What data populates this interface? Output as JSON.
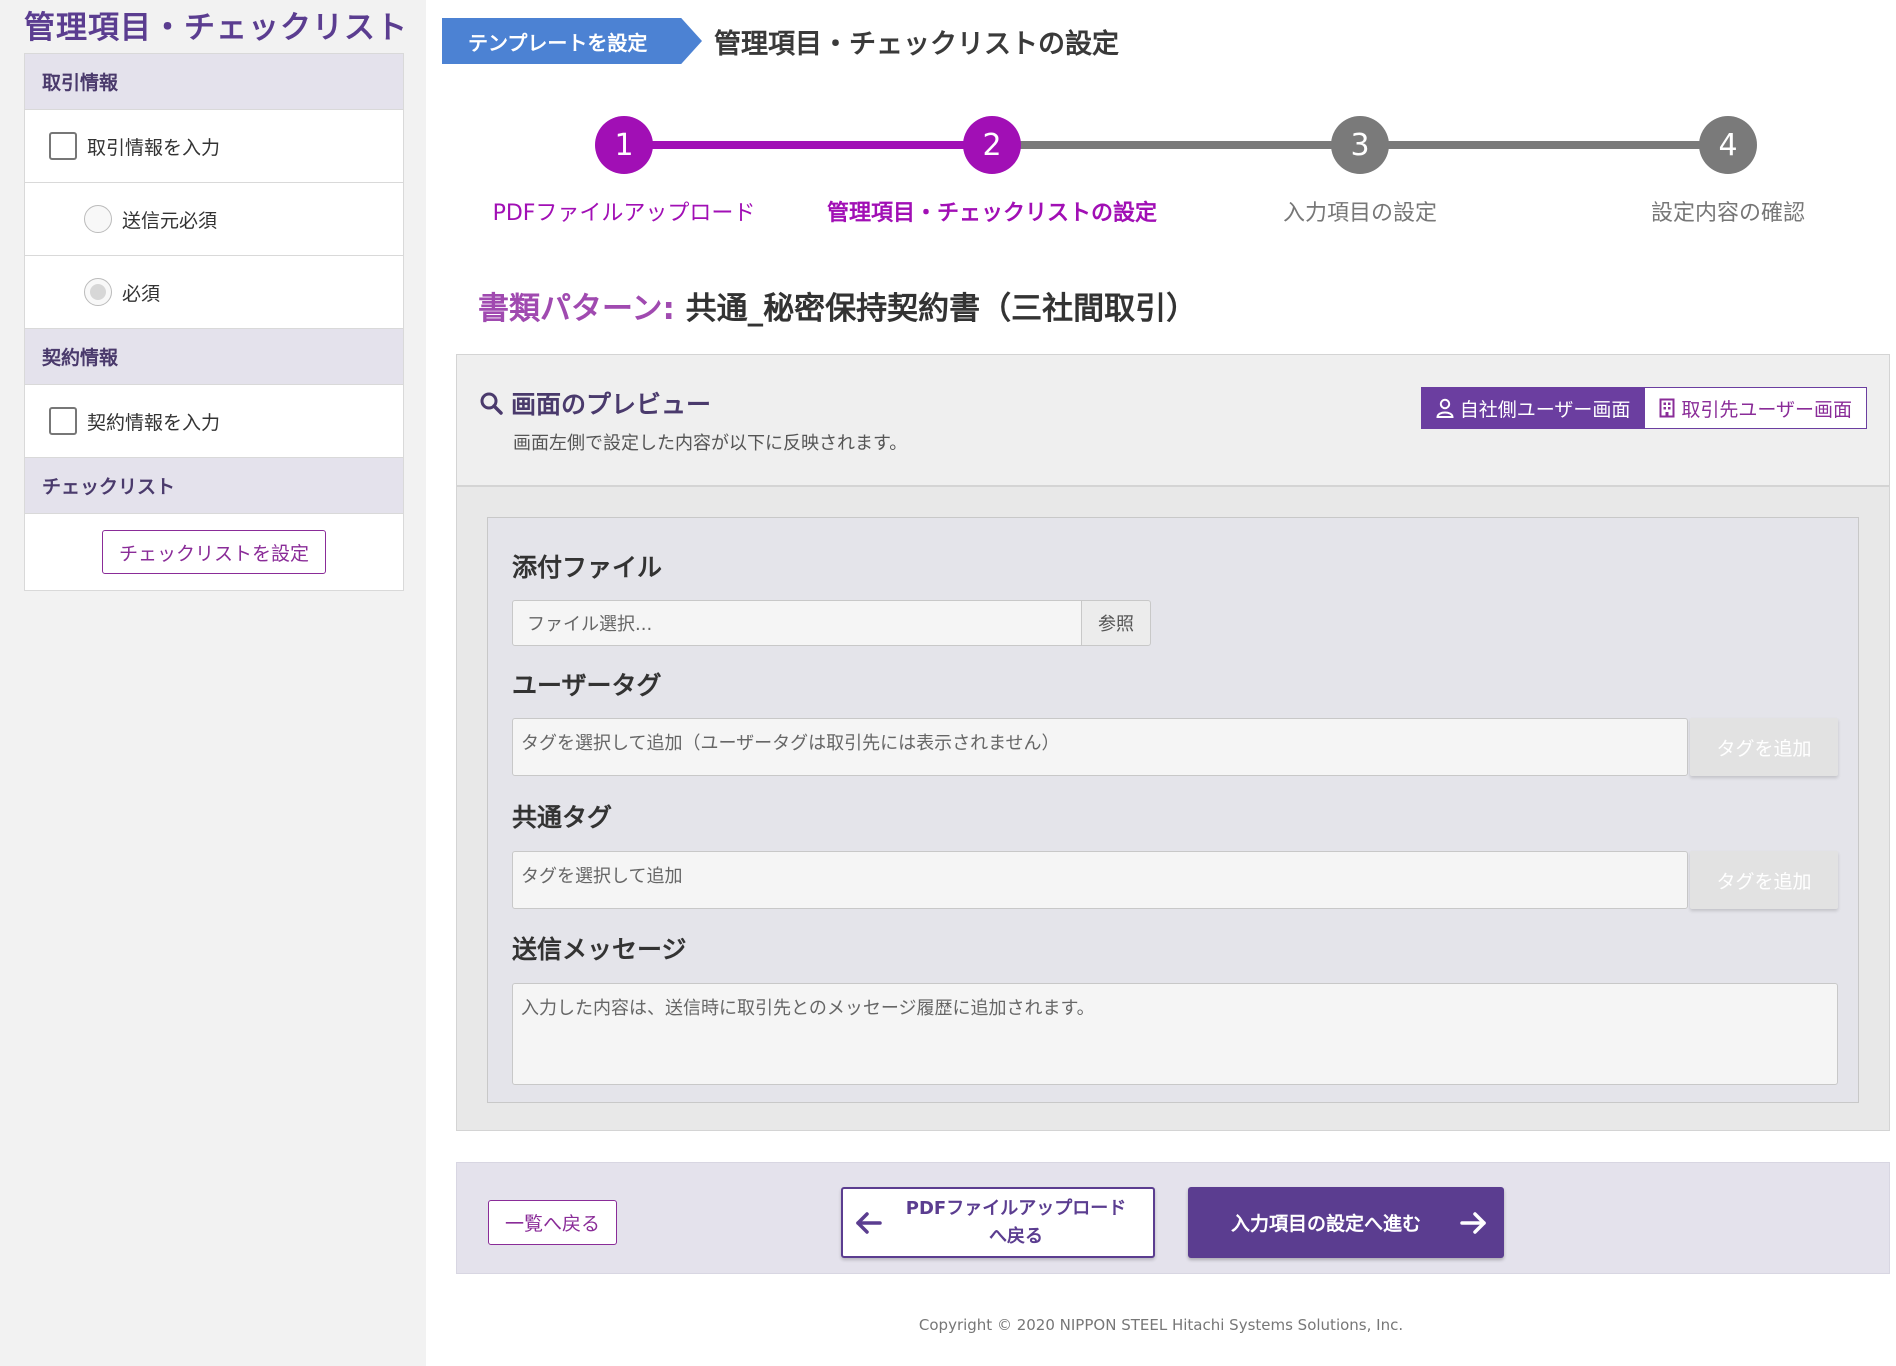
{
  "sidebar": {
    "title": "管理項目・チェックリスト",
    "torihiki_header": "取引情報",
    "torihiki_input": "取引情報を入力",
    "sender_required": "送信元必須",
    "required": "必須",
    "keiyaku_header": "契約情報",
    "keiyaku_input": "契約情報を入力",
    "checklist_header": "チェックリスト",
    "checklist_button": "チェックリストを設定"
  },
  "header": {
    "chip": "テンプレートを設定",
    "title": "管理項目・チェックリストの設定"
  },
  "stepper": {
    "steps": [
      {
        "num": "1",
        "label": "PDFファイルアップロード",
        "state": "done"
      },
      {
        "num": "2",
        "label": "管理項目・チェックリストの設定",
        "state": "current"
      },
      {
        "num": "3",
        "label": "入力項目の設定",
        "state": "todo"
      },
      {
        "num": "4",
        "label": "設定内容の確認",
        "state": "todo"
      }
    ]
  },
  "document": {
    "pattern_label": "書類パターン:",
    "pattern_value": "共通_秘密保持契約書（三社間取引）"
  },
  "preview": {
    "title": "画面のプレビュー",
    "subtitle": "画面左側で設定した内容が以下に反映されます。",
    "own_user_tab": "自社側ユーザー画面",
    "partner_user_tab": "取引先ユーザー画面",
    "attachment_label": "添付ファイル",
    "file_placeholder": "ファイル選択...",
    "browse": "参照",
    "user_tag_label": "ユーザータグ",
    "user_tag_placeholder": "タグを選択して追加（ユーザータグは取引先には表示されません）",
    "add_tag": "タグを追加",
    "common_tag_label": "共通タグ",
    "common_tag_placeholder": "タグを選択して追加",
    "message_label": "送信メッセージ",
    "message_placeholder": "入力した内容は、送信時に取引先とのメッセージ履歴に追加されます。"
  },
  "footer": {
    "back_to_list": "一覧へ戻る",
    "prev_line1": "PDFファイルアップロード",
    "prev_line2": "へ戻る",
    "next": "入力項目の設定へ進む",
    "copyright": "Copyright © 2020 NIPPON STEEL Hitachi Systems Solutions, Inc."
  },
  "colors": {
    "accent_purple": "#a10fb5",
    "primary_purple": "#5b3d90",
    "inactive_step": "#7a7a7a",
    "chip_blue": "#4c82d3"
  }
}
